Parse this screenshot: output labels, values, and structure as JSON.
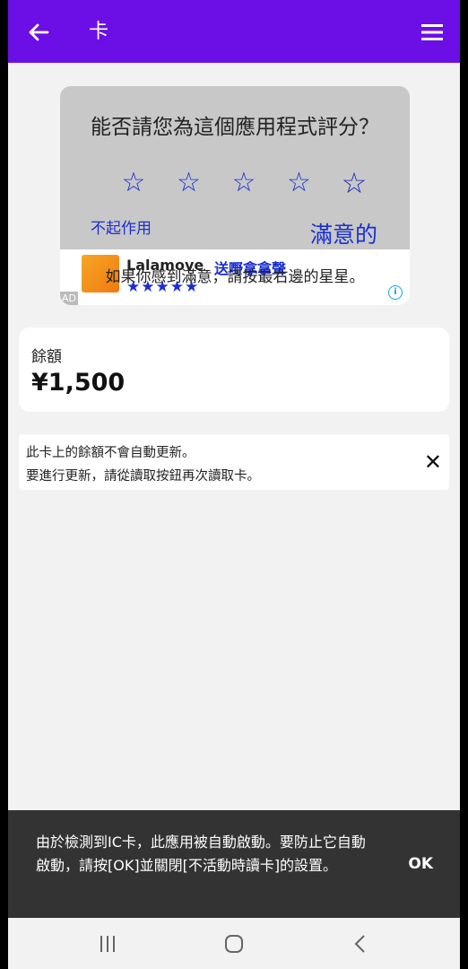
{
  "appbar": {
    "title": "卡",
    "back_icon": "arrow-back-icon",
    "menu_icon": "hamburger-menu-icon",
    "color": "#6b0fe6"
  },
  "rating": {
    "question": "能否請您為這個應用程式評分？",
    "stars": [
      "☆",
      "☆",
      "☆",
      "☆",
      "☆"
    ],
    "bad_label": "不起作用",
    "good_label": "滿意的",
    "hint": "如果你感到滿意，請按最右邊的星星。"
  },
  "ad": {
    "brand": "Lalamove",
    "tagline": "送嘢拿拿聲",
    "stars": "★★★★★",
    "ad_label": "AD",
    "info": "i"
  },
  "balance": {
    "label": "餘額",
    "amount": "¥1,500"
  },
  "notice": {
    "line1": "此卡上的餘額不會自動更新。",
    "line2": "要進行更新，請從讀取按鈕再次讀取卡。",
    "close": "✕"
  },
  "snackbar": {
    "message": "由於檢測到IC卡，此應用被自動啟動。要防止它自動啟動，請按[OK]並關閉[不活動時讀卡]的設置。",
    "action": "OK"
  },
  "navbar": {
    "recents_icon": "recents-icon",
    "home_icon": "home-icon",
    "back_icon": "nav-back-icon"
  }
}
